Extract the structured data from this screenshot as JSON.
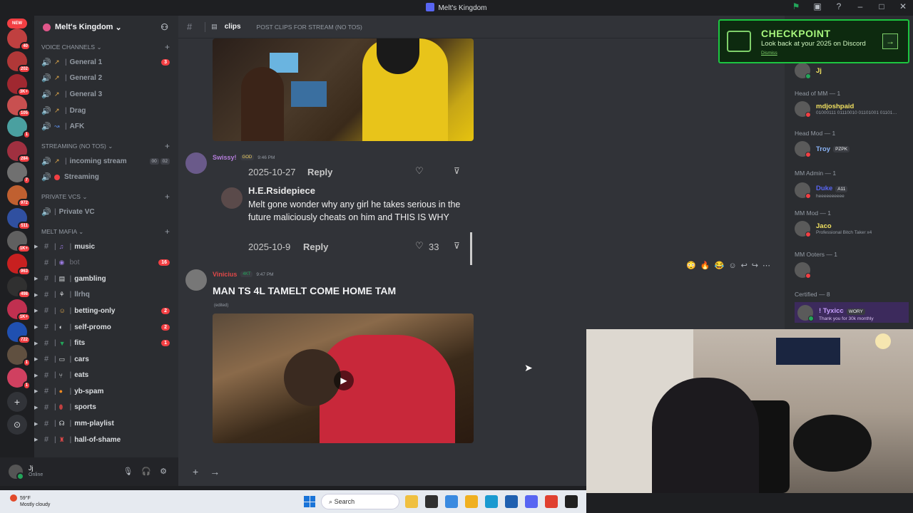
{
  "window": {
    "title": "Melt's Kingdom"
  },
  "servers": {
    "new_label": "NEW",
    "badges": [
      "40",
      "202",
      "3K+",
      "105",
      "1",
      "284",
      "7",
      "972",
      "511",
      "1K+",
      "963",
      "498",
      "1K+",
      "722",
      "1",
      "1"
    ]
  },
  "guild": {
    "name": "Melt's Kingdom"
  },
  "categories": {
    "voice": "VOICE CHANNELS",
    "streaming": "STREAMING (NO TOS)",
    "private": "PRIVATE VCS",
    "mafia": "MELT MAFIA"
  },
  "voice_channels": [
    {
      "name": "General 1",
      "badge": "3"
    },
    {
      "name": "General 2",
      "badge": ""
    },
    {
      "name": "General 3",
      "badge": ""
    },
    {
      "name": "Drag",
      "badge": ""
    },
    {
      "name": "AFK",
      "badge": ""
    }
  ],
  "streaming_channels": [
    {
      "name": "incoming stream",
      "counts": [
        "00",
        "02"
      ]
    },
    {
      "name": "Streaming"
    }
  ],
  "private_channels": [
    {
      "name": "Private VC"
    }
  ],
  "text_channels": [
    {
      "name": "music",
      "badge": ""
    },
    {
      "name": "bot",
      "badge": "16"
    },
    {
      "name": "gambling",
      "badge": ""
    },
    {
      "name": "llrhq",
      "badge": ""
    },
    {
      "name": "betting-only",
      "badge": "2"
    },
    {
      "name": "self-promo",
      "badge": "2"
    },
    {
      "name": "fits",
      "badge": "1"
    },
    {
      "name": "cars",
      "badge": ""
    },
    {
      "name": "eats",
      "badge": ""
    },
    {
      "name": "yb-spam",
      "badge": ""
    },
    {
      "name": "sports",
      "badge": ""
    },
    {
      "name": "mm-playlist",
      "badge": ""
    },
    {
      "name": "hall-of-shame",
      "badge": ""
    }
  ],
  "user": {
    "name": "Jj",
    "status": "Online"
  },
  "channel_header": {
    "name": "clips",
    "topic": "POST CLIPS FOR STREAM (NO TOS)"
  },
  "messages": {
    "m1": {
      "author": "Swissy!",
      "role": "GOD",
      "time": "9:46 PM",
      "author_color": "#b57edc"
    },
    "comment": {
      "date_top": "2025-10-27",
      "reply": "Reply",
      "author": "H.E.Rsidepiece",
      "text": "Melt gone wonder why any girl he takes serious in the future maliciously cheats on him and THIS IS WHY",
      "date_bottom": "2025-10-9",
      "likes": "33"
    },
    "m2": {
      "author": "Vinicius",
      "role": "4KT",
      "time": "9:47 PM",
      "text": "MAN TS 4L TAMELT COME HOME TAM",
      "edited": "(edited)",
      "author_color": "#e04848"
    }
  },
  "members": {
    "top_member": "Jj",
    "groups": [
      {
        "role": "Head of MM — 1",
        "name": "mdjoshpaid",
        "sub": "01000111 01110010 01101001 01101…",
        "color": "#f0e060"
      },
      {
        "role": "Head Mod — 1",
        "name": "Troy",
        "tag": "PZPK",
        "color": "#8ab4f8"
      },
      {
        "role": "MM Admin — 1",
        "name": "Duke",
        "tag": "A11",
        "sub": "heeeeeeeeee",
        "color": "#5865f2"
      },
      {
        "role": "MM Mod — 1",
        "name": "Jaco",
        "sub": "Professional Bitch Taker x4",
        "color": "#f0e060"
      },
      {
        "role": "MM Ooters — 1",
        "name": "",
        "color": "#dbdee1"
      },
      {
        "role": "Certified — 8",
        "name": "! Tyxicc",
        "tag": "WORY",
        "sub": "Thank you for 30k monthly",
        "color": "#c8a0ff"
      }
    ]
  },
  "checkpoint": {
    "title": "CHECKPOINT",
    "subtitle": "Look back at your 2025 on Discord",
    "dismiss": "Dismiss"
  },
  "taskbar": {
    "temp": "59°F",
    "weather": "Mostly cloudy",
    "search": "Search"
  }
}
